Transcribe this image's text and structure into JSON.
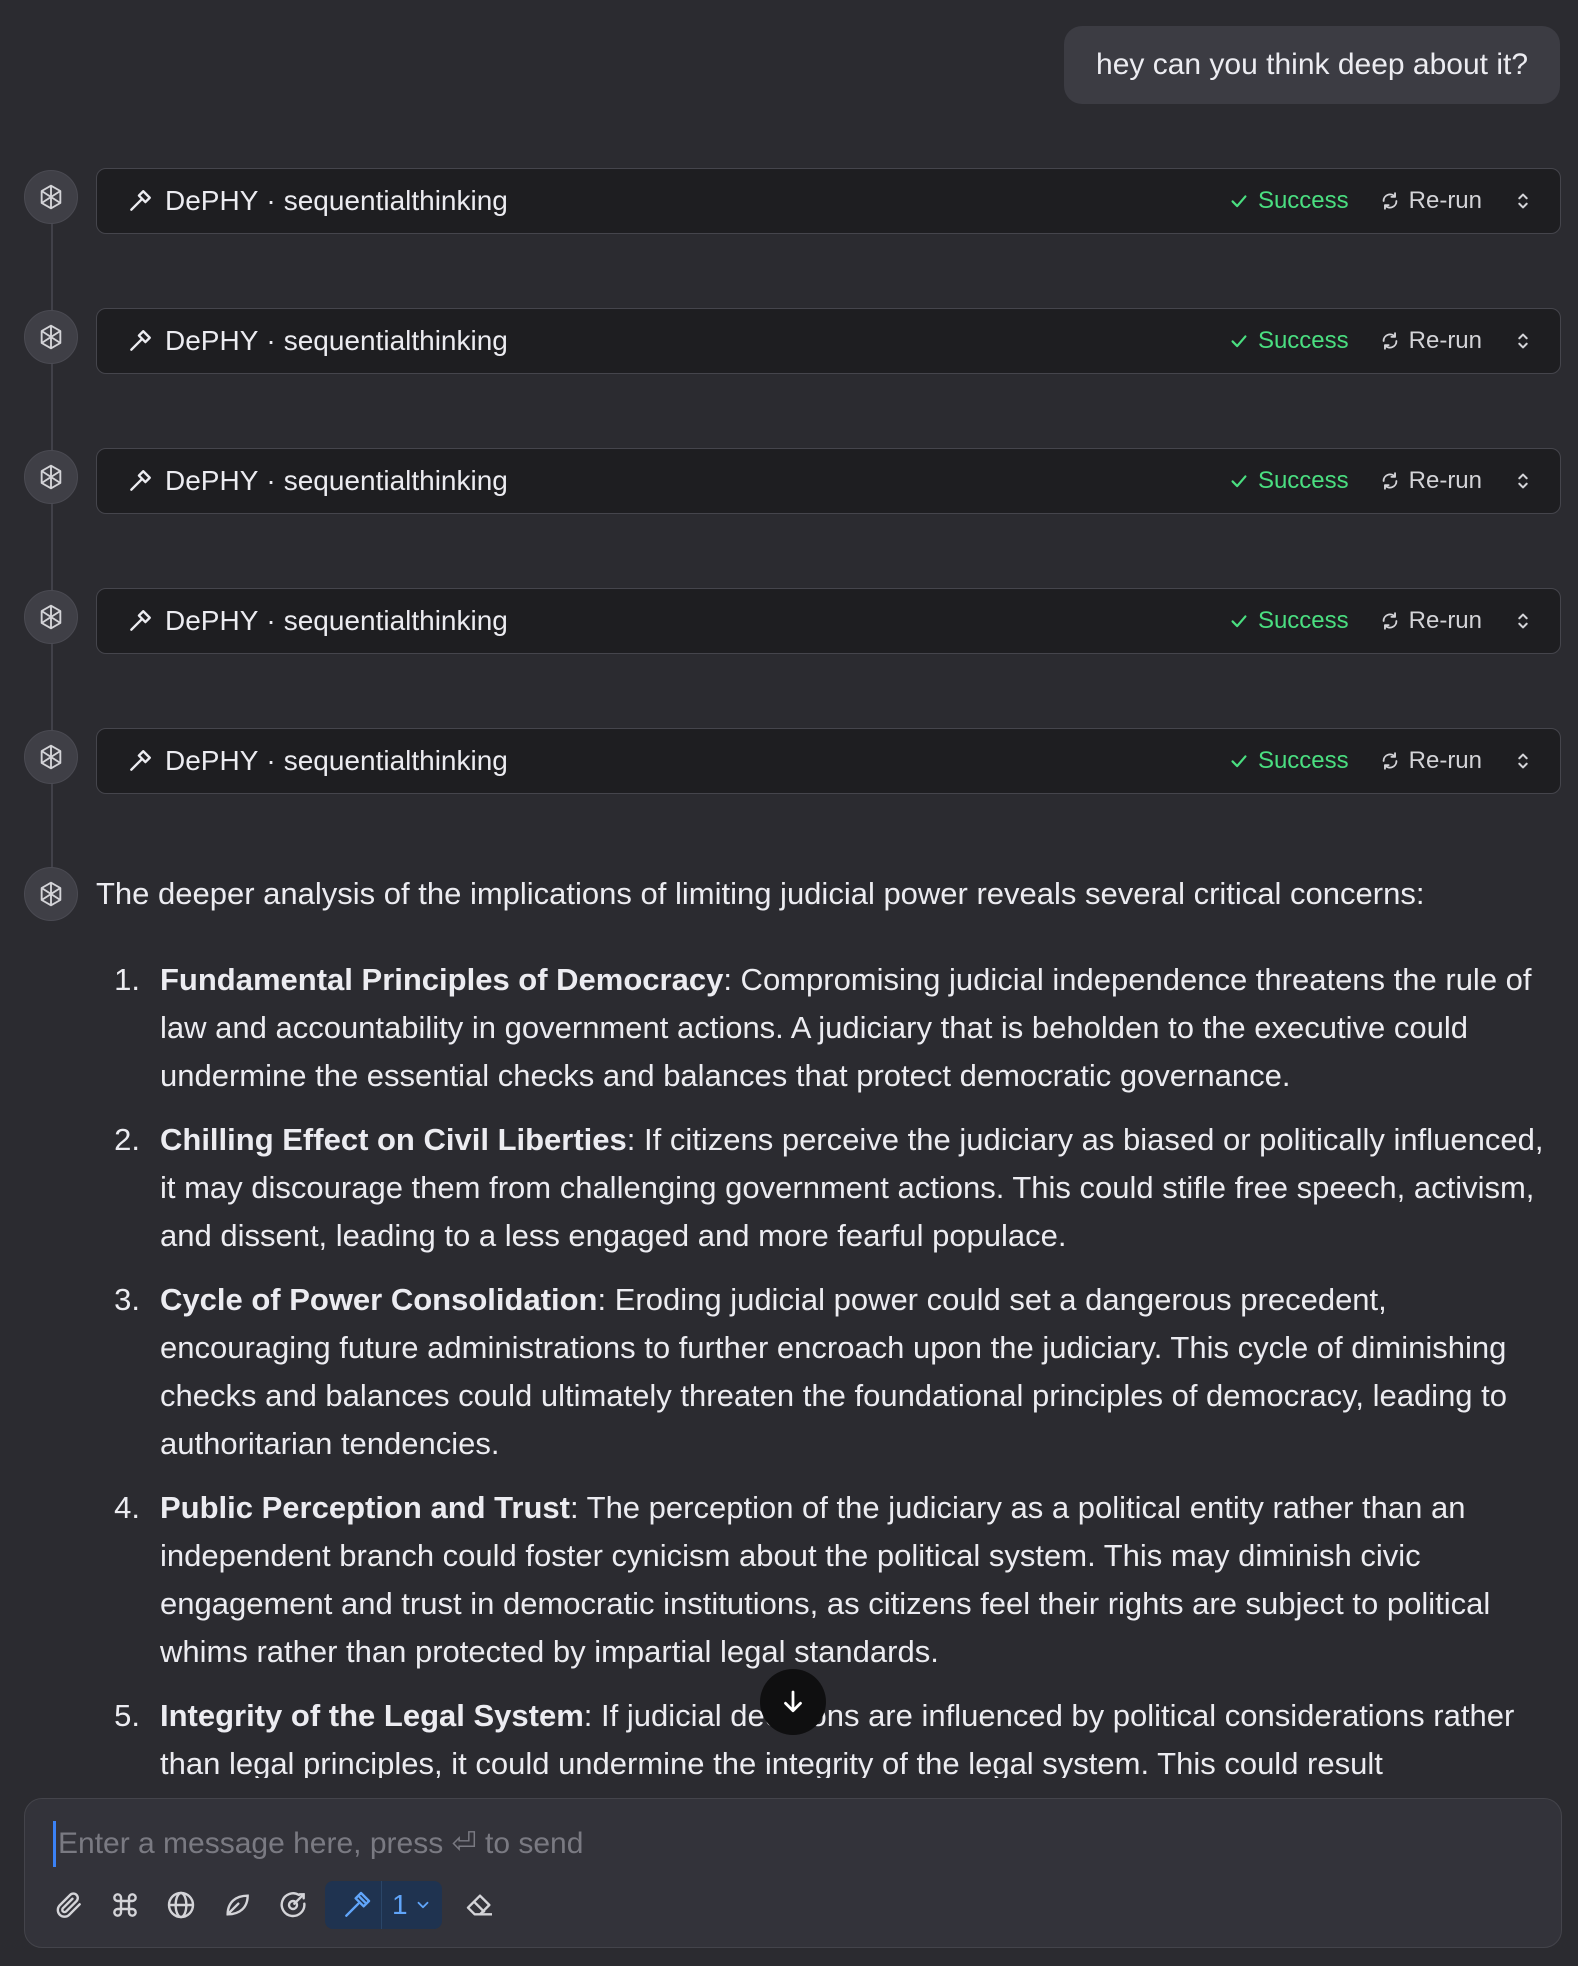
{
  "user_message": "hey can you think deep about it?",
  "tool_calls": [
    {
      "provider": "DePHY",
      "separator": "·",
      "tool": "sequentialthinking",
      "status": "Success",
      "rerun_label": "Re-run"
    },
    {
      "provider": "DePHY",
      "separator": "·",
      "tool": "sequentialthinking",
      "status": "Success",
      "rerun_label": "Re-run"
    },
    {
      "provider": "DePHY",
      "separator": "·",
      "tool": "sequentialthinking",
      "status": "Success",
      "rerun_label": "Re-run"
    },
    {
      "provider": "DePHY",
      "separator": "·",
      "tool": "sequentialthinking",
      "status": "Success",
      "rerun_label": "Re-run"
    },
    {
      "provider": "DePHY",
      "separator": "·",
      "tool": "sequentialthinking",
      "status": "Success",
      "rerun_label": "Re-run"
    }
  ],
  "answer": {
    "intro": "The deeper analysis of the implications of limiting judicial power reveals several critical concerns:",
    "items": [
      {
        "num": "1.",
        "title": "Fundamental Principles of Democracy",
        "text": ": Compromising judicial independence threatens the rule of law and accountability in government actions. A judiciary that is beholden to the executive could undermine the essential checks and balances that protect democratic governance."
      },
      {
        "num": "2.",
        "title": "Chilling Effect on Civil Liberties",
        "text": ": If citizens perceive the judiciary as biased or politically influenced, it may discourage them from challenging government actions. This could stifle free speech, activism, and dissent, leading to a less engaged and more fearful populace."
      },
      {
        "num": "3.",
        "title": "Cycle of Power Consolidation",
        "text": ": Eroding judicial power could set a dangerous precedent, encouraging future administrations to further encroach upon the judiciary. This cycle of diminishing checks and balances could ultimately threaten the foundational principles of democracy, leading to authoritarian tendencies."
      },
      {
        "num": "4.",
        "title": "Public Perception and Trust",
        "text": ": The perception of the judiciary as a political entity rather than an independent branch could foster cynicism about the political system. This may diminish civic engagement and trust in democratic institutions, as citizens feel their rights are subject to political whims rather than protected by impartial legal standards."
      },
      {
        "num": "5.",
        "title": "Integrity of the Legal System",
        "text": ": If judicial decisions are influenced by political considerations rather than legal principles, it could undermine the integrity of the legal system. This could result"
      }
    ]
  },
  "composer": {
    "placeholder": "Enter a message here, press ⏎ to send",
    "tool_count": "1"
  },
  "colors": {
    "background": "#2b2b30",
    "success": "#4ade80",
    "accent": "#3b82f6"
  }
}
